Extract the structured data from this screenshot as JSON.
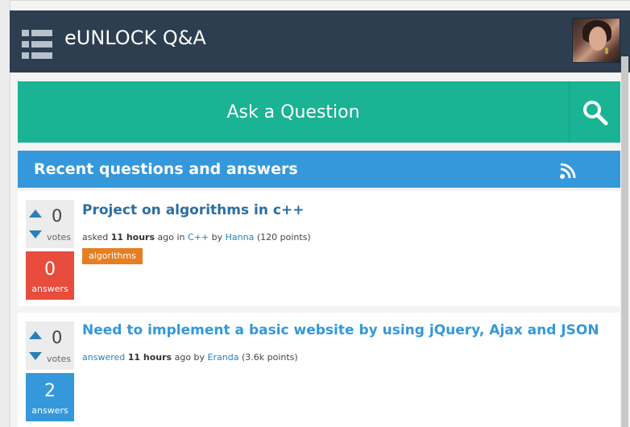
{
  "header": {
    "site_title": "eUNLOCK Q&A",
    "menu_icon": "list-menu-icon",
    "avatar": "user-avatar"
  },
  "ask": {
    "label": "Ask a Question",
    "search_icon": "search-icon"
  },
  "section": {
    "title": "Recent questions and answers",
    "rss_icon": "rss-icon"
  },
  "questions": [
    {
      "votes": "0",
      "votes_label": "votes",
      "answers": "0",
      "answers_label": "answers",
      "answers_color": "#e74c3c",
      "title": "Project on algorithms in c++",
      "meta": {
        "action": "asked",
        "when": "11 hours",
        "ago": "ago in",
        "category": "C++",
        "by": "by",
        "user": "Hanna",
        "points": "(120 points)"
      },
      "tags": [
        "algorithms"
      ]
    },
    {
      "votes": "0",
      "votes_label": "votes",
      "answers": "2",
      "answers_label": "answers",
      "answers_color": "#3498db",
      "title": "Need to implement a basic website by using jQuery, Ajax and JSON",
      "meta": {
        "action": "answered",
        "when": "11 hours",
        "ago": "ago by",
        "user": "Eranda",
        "points": "(3.6k points)"
      },
      "tags": []
    }
  ],
  "colors": {
    "topbar": "#2c3e50",
    "ask_bar": "#1ab394",
    "section_header": "#3498db",
    "tag": "#e67e22"
  }
}
